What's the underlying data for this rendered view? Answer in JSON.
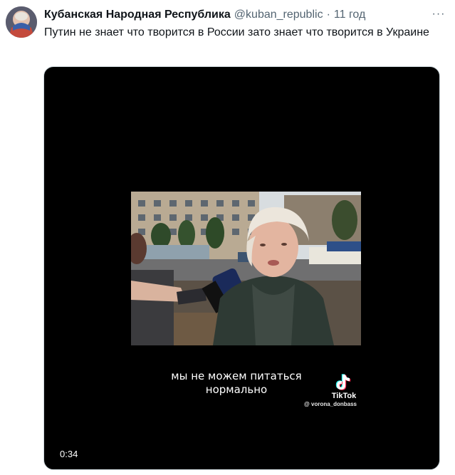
{
  "tweet": {
    "author": {
      "display_name": "Кубанская Народная Республика",
      "handle": "@kuban_republic",
      "separator": "·",
      "time": "11 год"
    },
    "more_icon": "more-horizontal-icon",
    "more_label": "···",
    "text": "Путин не знает что творится в России зато знает что творится в Украине"
  },
  "video": {
    "subtitle_line1": "мы не можем питаться",
    "subtitle_line2": "нормально",
    "watermark": {
      "icon": "tiktok-logo-icon",
      "brand": "TikTok",
      "username": "@ vorona_donbass"
    },
    "duration": "0:34"
  },
  "colors": {
    "text_primary": "#0f1419",
    "text_secondary": "#536471",
    "media_background": "#000000",
    "tiktok_cyan": "#25f4ee",
    "tiktok_red": "#fe2c55"
  }
}
